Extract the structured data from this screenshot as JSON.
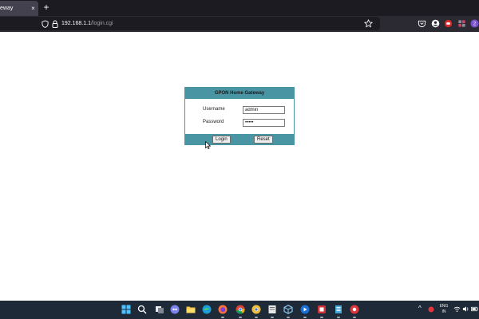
{
  "browser": {
    "tab_title": "eway",
    "tab_close": "×",
    "new_tab": "+",
    "url_host": "192.168.1.1",
    "url_path": "/login.cgi",
    "profile_badge": "2"
  },
  "login": {
    "header": "GPON Home Gateway",
    "username_label": "Username",
    "username_value": "admin",
    "password_label": "Password",
    "password_value": "admin",
    "login_button": "Login",
    "reset_button": "Reset"
  },
  "taskbar": {
    "tray_chevron": "^",
    "language": "ENG",
    "region": "IN"
  },
  "colors": {
    "accent": "#4a95a3",
    "chrome_dark": "#1c1b22",
    "taskbar": "#1f2a38"
  },
  "icons": {
    "windows": "windows-start-icon",
    "search": "search-icon",
    "firefox": "firefox-icon",
    "chrome": "chrome-icon",
    "edge": "edge-icon"
  }
}
